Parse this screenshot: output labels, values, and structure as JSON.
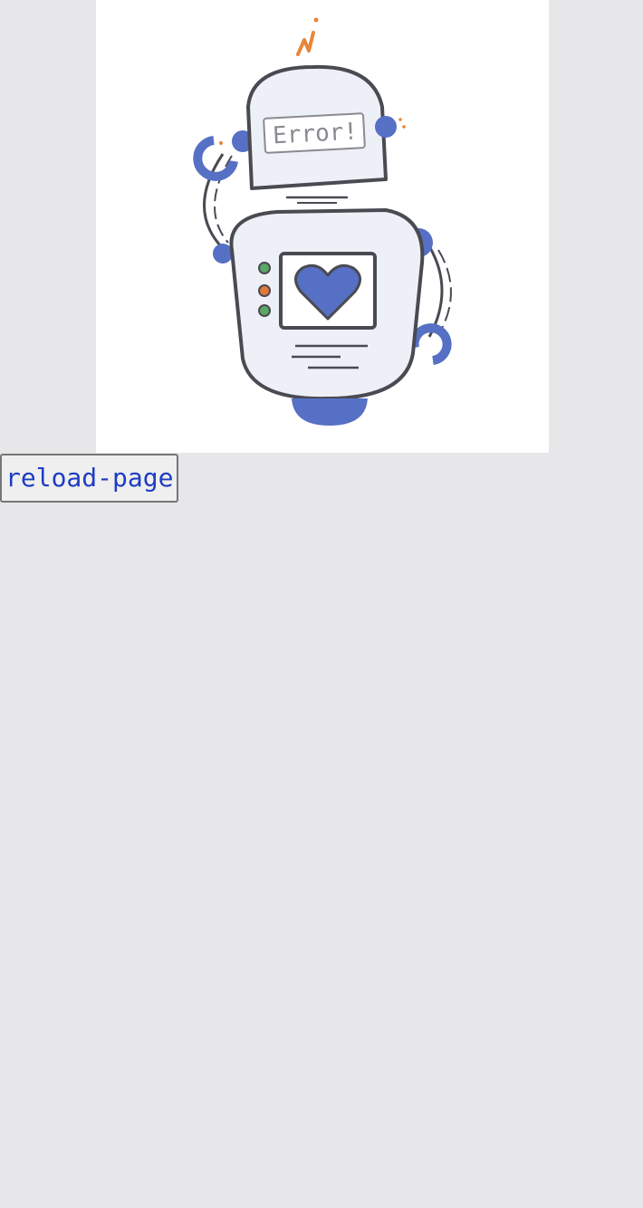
{
  "illustration": {
    "screen_text": "Error!",
    "colors": {
      "outline": "#4a4a52",
      "body_fill": "#eef0f7",
      "accent_blue": "#5570c4",
      "spark_orange": "#e8863a",
      "led_green": "#5aa866",
      "led_orange": "#e0793a",
      "screen_text": "#8a8a92"
    }
  },
  "reload_button": {
    "label": "reload-page"
  }
}
